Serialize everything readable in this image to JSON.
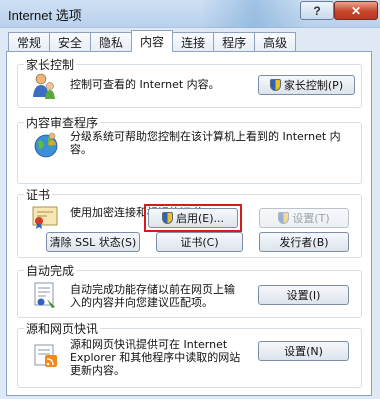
{
  "window": {
    "title": "Internet 选项",
    "help_label": "?",
    "close_label": "✕"
  },
  "tabs": [
    {
      "label": "常规"
    },
    {
      "label": "安全"
    },
    {
      "label": "隐私"
    },
    {
      "label": "内容",
      "active": true
    },
    {
      "label": "连接"
    },
    {
      "label": "程序"
    },
    {
      "label": "高级"
    }
  ],
  "parental": {
    "title": "家长控制",
    "desc": "控制可查看的 Internet 内容。",
    "button": "家长控制(P)",
    "icon": "parental-users-icon"
  },
  "advisor": {
    "title": "内容审查程序",
    "desc_line1": "分级系统可帮助您控制在该计算机上看到的 Internet 内",
    "desc_line2": "容。",
    "enable_button": "启用(E)...",
    "settings_button": "设置(T)",
    "icon": "globe-person-icon"
  },
  "certificates": {
    "title": "证书",
    "desc": "使用加密连接和标识的证书。",
    "clear_ssl_button": "清除 SSL 状态(S)",
    "certs_button": "证书(C)",
    "publishers_button": "发行者(B)",
    "icon": "certificate-icon"
  },
  "autocomplete": {
    "title": "自动完成",
    "desc_line1": "自动完成功能存储以前在网页上输",
    "desc_line2": "入的内容并向您建议匹配项。",
    "settings_button": "设置(I)",
    "icon": "autocomplete-icon"
  },
  "feeds": {
    "title": "源和网页快讯",
    "desc_line1": "源和网页快讯提供可在 Internet",
    "desc_line2": "Explorer 和其他程序中读取的网站",
    "desc_line3": "更新内容。",
    "settings_button": "设置(N)",
    "icon": "feeds-icon"
  }
}
